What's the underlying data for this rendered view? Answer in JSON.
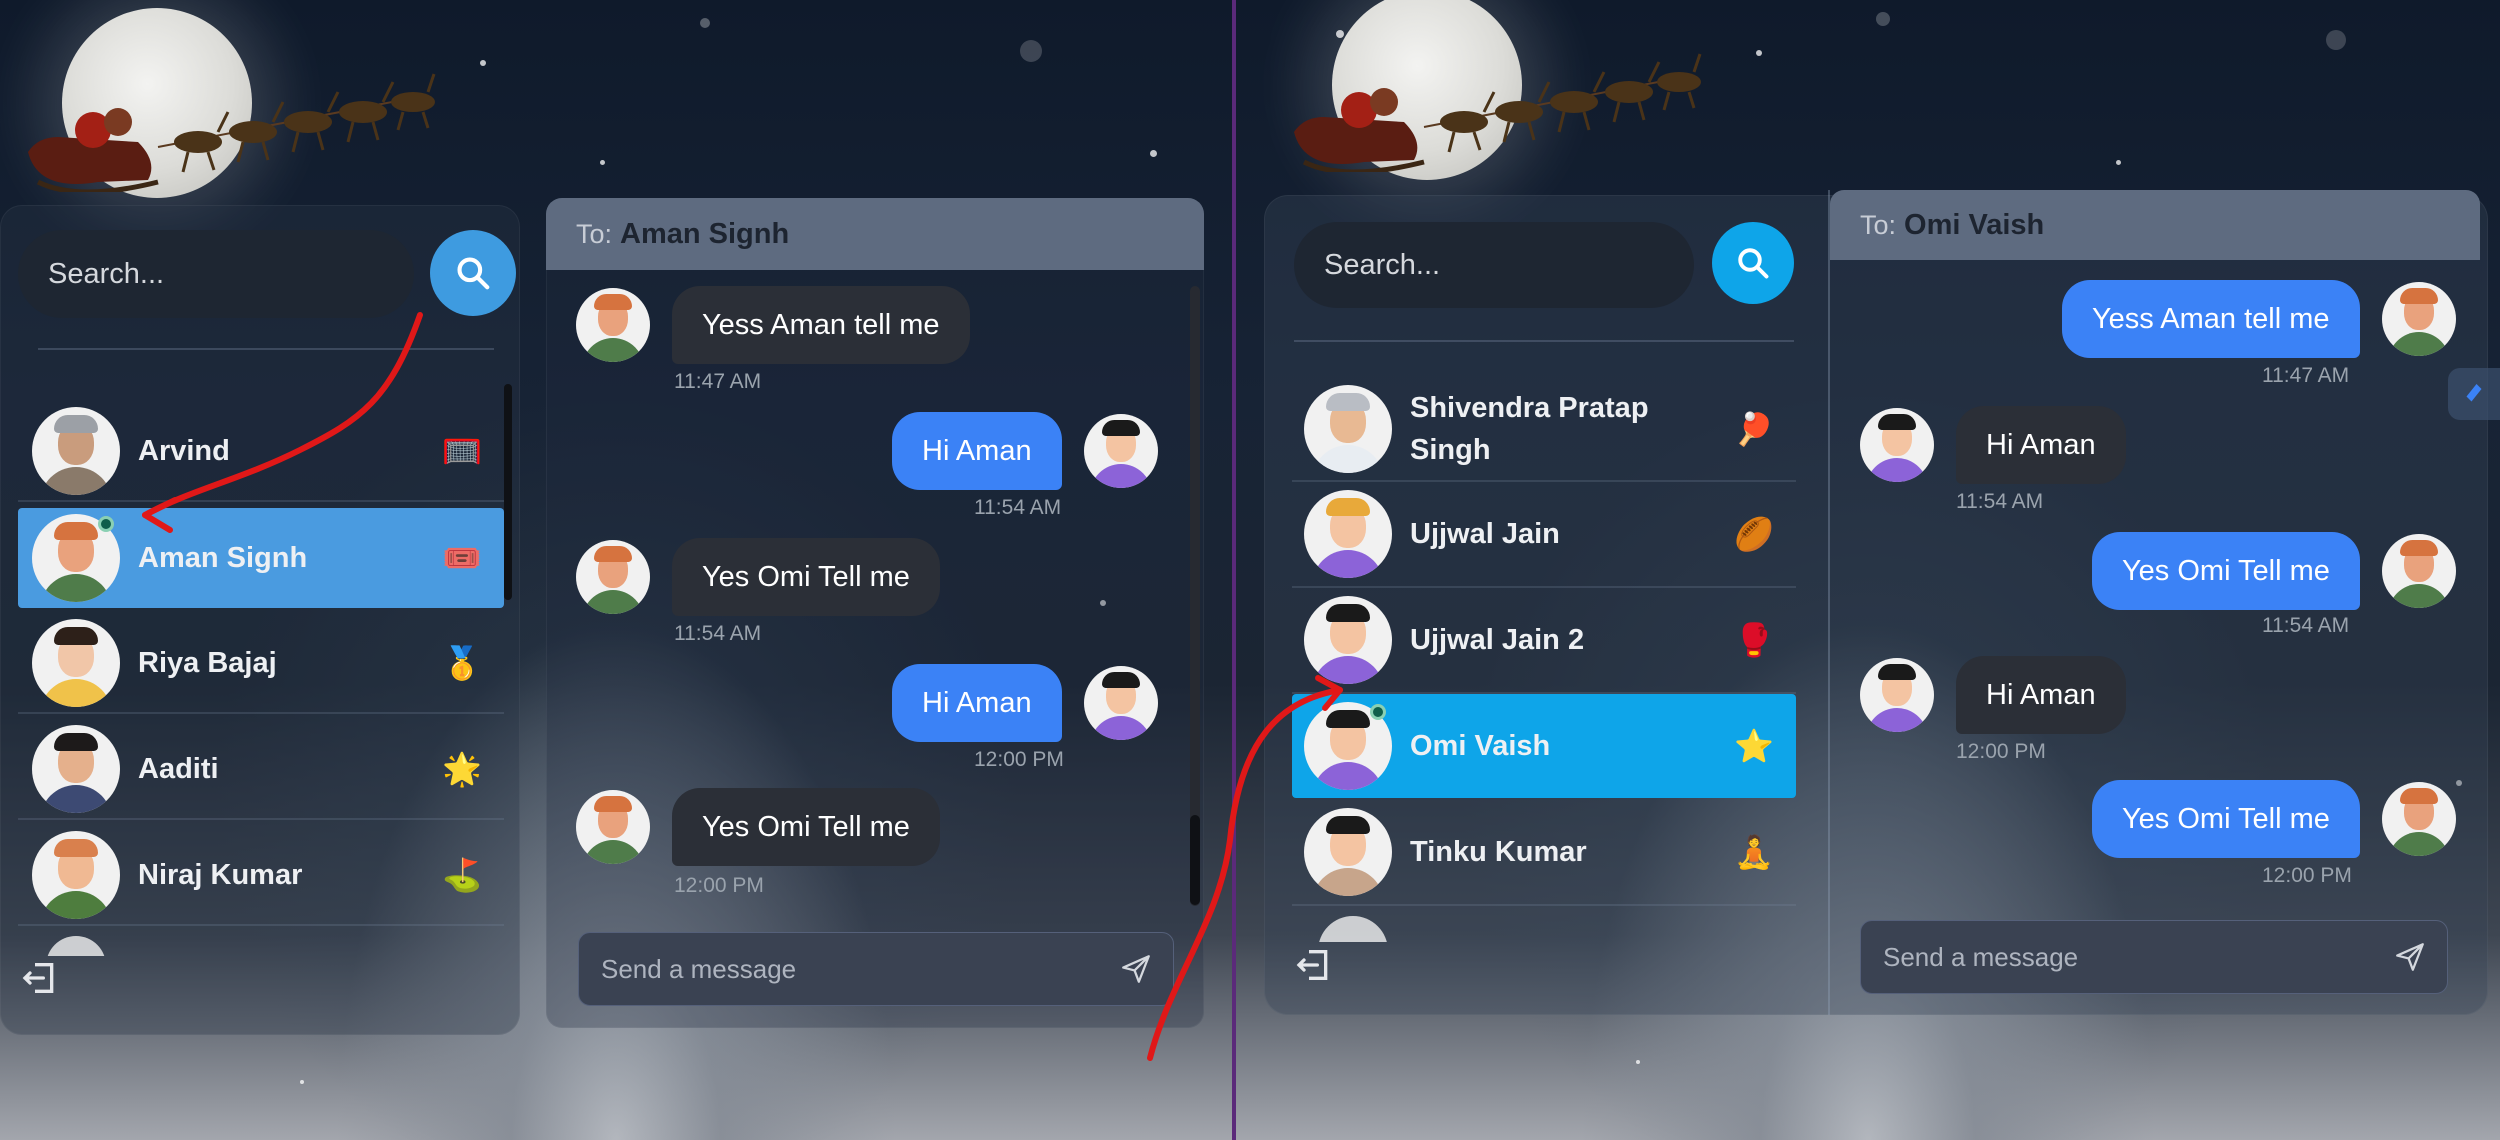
{
  "left_panel": {
    "search": {
      "placeholder": "Search..."
    },
    "contacts": [
      {
        "name": "Arvind",
        "emoji": "🥅",
        "active": false
      },
      {
        "name": "Aman Signh",
        "emoji": "🎟️",
        "active": true,
        "online": true
      },
      {
        "name": "Riya Bajaj",
        "emoji": "🥇",
        "active": false
      },
      {
        "name": "Aaditi",
        "emoji": "🌟",
        "active": false
      },
      {
        "name": "Niraj Kumar",
        "emoji": "⛳",
        "active": false
      }
    ],
    "chat": {
      "to_label": "To:",
      "to_name": "Aman Signh",
      "messages": [
        {
          "text": "Yess Aman tell me",
          "time": "11:47 AM",
          "direction": "in"
        },
        {
          "text": "Hi Aman",
          "time": "11:54 AM",
          "direction": "out"
        },
        {
          "text": "Yes Omi Tell me",
          "time": "11:54 AM",
          "direction": "in"
        },
        {
          "text": "Hi Aman",
          "time": "12:00 PM",
          "direction": "out"
        },
        {
          "text": "Yes Omi Tell me",
          "time": "12:00 PM",
          "direction": "in"
        }
      ],
      "input_placeholder": "Send a message"
    }
  },
  "right_panel": {
    "search": {
      "placeholder": "Search..."
    },
    "contacts": [
      {
        "name": "Shivendra Pratap Singh",
        "emoji": "🏓",
        "active": false
      },
      {
        "name": "Ujjwal Jain",
        "emoji": "🏉",
        "active": false
      },
      {
        "name": "Ujjwal Jain 2",
        "emoji": "🥊",
        "active": false
      },
      {
        "name": "Omi Vaish",
        "emoji": "⭐",
        "active": true,
        "online": true
      },
      {
        "name": "Tinku Kumar",
        "emoji": "🧘",
        "active": false
      }
    ],
    "chat": {
      "to_label": "To:",
      "to_name": "Omi Vaish",
      "messages": [
        {
          "text": "Yess Aman tell me",
          "time": "11:47 AM",
          "direction": "out"
        },
        {
          "text": "Hi Aman",
          "time": "11:54 AM",
          "direction": "in"
        },
        {
          "text": "Yes Omi Tell me",
          "time": "11:54 AM",
          "direction": "out"
        },
        {
          "text": "Hi Aman",
          "time": "12:00 PM",
          "direction": "in"
        },
        {
          "text": "Yes Omi Tell me",
          "time": "12:00 PM",
          "direction": "out"
        }
      ],
      "input_placeholder": "Send a message"
    }
  },
  "colors": {
    "active_left": "#4a9be0",
    "active_right": "#0ea5e9",
    "search_button": "#0ea5e9",
    "outgoing_bubble": "#3b82f6",
    "incoming_bubble": "#2b2f37",
    "annotation_arrow": "#e01818"
  },
  "icons": [
    "search-icon",
    "logout-icon",
    "send-icon",
    "online-status-icon"
  ]
}
